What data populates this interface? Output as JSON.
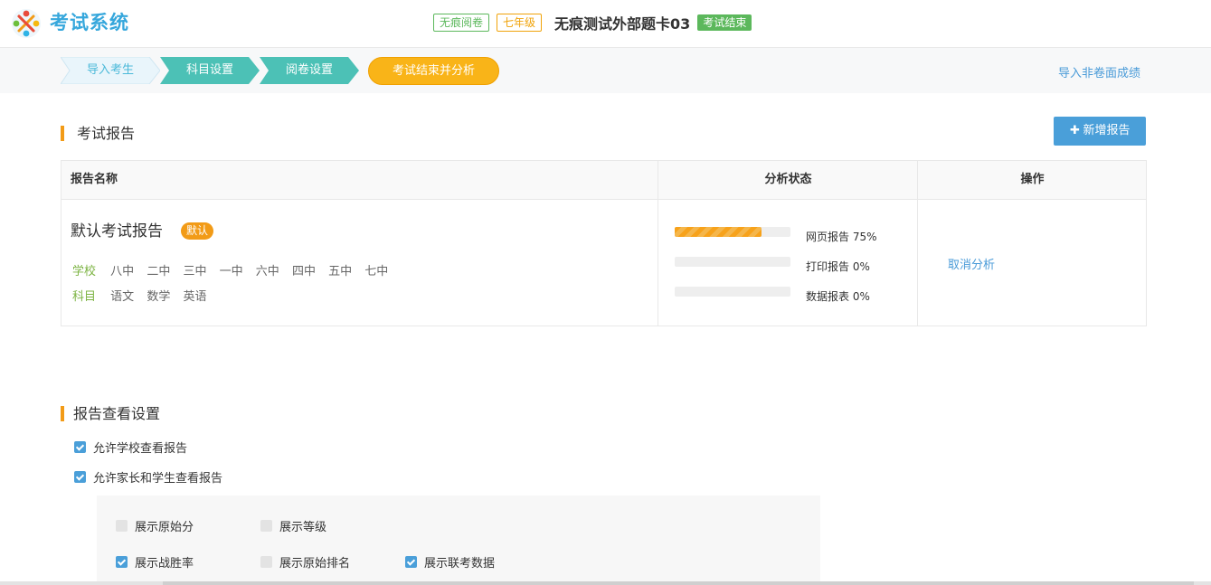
{
  "header": {
    "brand": "考试系统",
    "tags": {
      "mode": "无痕阅卷",
      "grade": "七年级"
    },
    "exam_title": "无痕测试外部题卡03",
    "status": "考试结束",
    "colors": {
      "brand": "#36a7dc",
      "accent": "#f29b17",
      "success": "#5cb85c"
    }
  },
  "steps": [
    "导入考生",
    "科目设置",
    "阅卷设置",
    "考试结束并分析"
  ],
  "import_link": "导入非卷面成绩",
  "report_section": {
    "title": "考试报告",
    "add_button": "新增报告",
    "columns": [
      "报告名称",
      "分析状态",
      "操作"
    ],
    "row": {
      "name": "默认考试报告",
      "badge": "默认",
      "school_key": "学校",
      "schools": [
        "八中",
        "二中",
        "三中",
        "一中",
        "六中",
        "四中",
        "五中",
        "七中"
      ],
      "subject_key": "科目",
      "subjects": [
        "语文",
        "数学",
        "英语"
      ],
      "progress": [
        {
          "label": "网页报告 75%",
          "value": 75
        },
        {
          "label": "打印报告 0%",
          "value": 0
        },
        {
          "label": "数据报表 0%",
          "value": 0
        }
      ],
      "action": "取消分析"
    }
  },
  "view_section": {
    "title": "报告查看设置",
    "options": [
      {
        "label": "允许学校查看报告",
        "checked": true
      },
      {
        "label": "允许家长和学生查看报告",
        "checked": true
      }
    ],
    "display_options": [
      {
        "label": "展示原始分",
        "checked": false
      },
      {
        "label": "展示等级",
        "checked": false
      },
      {
        "label": "展示战胜率",
        "checked": true
      },
      {
        "label": "展示原始排名",
        "checked": false
      },
      {
        "label": "展示联考数据",
        "checked": true
      }
    ]
  }
}
